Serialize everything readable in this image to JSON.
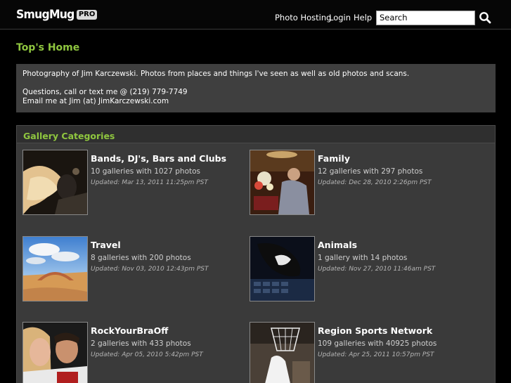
{
  "header": {
    "logo_text": "SmugMug",
    "logo_badge": "PRO",
    "nav": {
      "photo_hosting": "Photo Hosting",
      "login": "Login",
      "help": "Help"
    },
    "search": {
      "value": "Search"
    }
  },
  "page_title": "Top's Home",
  "bio": {
    "line1": "Photography of Jim Karczewski. Photos from places and things I've seen as well as old photos and scans.",
    "line2": "Questions, call or text me @ (219) 779-7749",
    "line3": "Email me at Jim (at) JimKarczewski.com"
  },
  "gallery_categories": {
    "title": "Gallery Categories",
    "items": [
      {
        "name": "Bands, DJ's, Bars and Clubs",
        "count": "10 galleries with 1027 photos",
        "updated": "Updated: Mar 13, 2011 11:25pm PST"
      },
      {
        "name": "Family",
        "count": "12 galleries with 297 photos",
        "updated": "Updated: Dec 28, 2010 2:26pm PST"
      },
      {
        "name": "Travel",
        "count": "8 galleries with 200 photos",
        "updated": "Updated: Nov 03, 2010 12:43pm PST"
      },
      {
        "name": "Animals",
        "count": "1 gallery with 14 photos",
        "updated": "Updated: Nov 27, 2010 11:46am PST"
      },
      {
        "name": "RockYourBraOff",
        "count": "2 galleries with 433 photos",
        "updated": "Updated: Apr 05, 2010 5:42pm PST"
      },
      {
        "name": "Region Sports Network",
        "count": "109 galleries with 40925 photos",
        "updated": "Updated: Apr 25, 2011 10:57pm PST"
      }
    ]
  },
  "colors": {
    "accent_green": "#8fc63f",
    "panel": "#3f3f3f",
    "background": "#000000"
  }
}
